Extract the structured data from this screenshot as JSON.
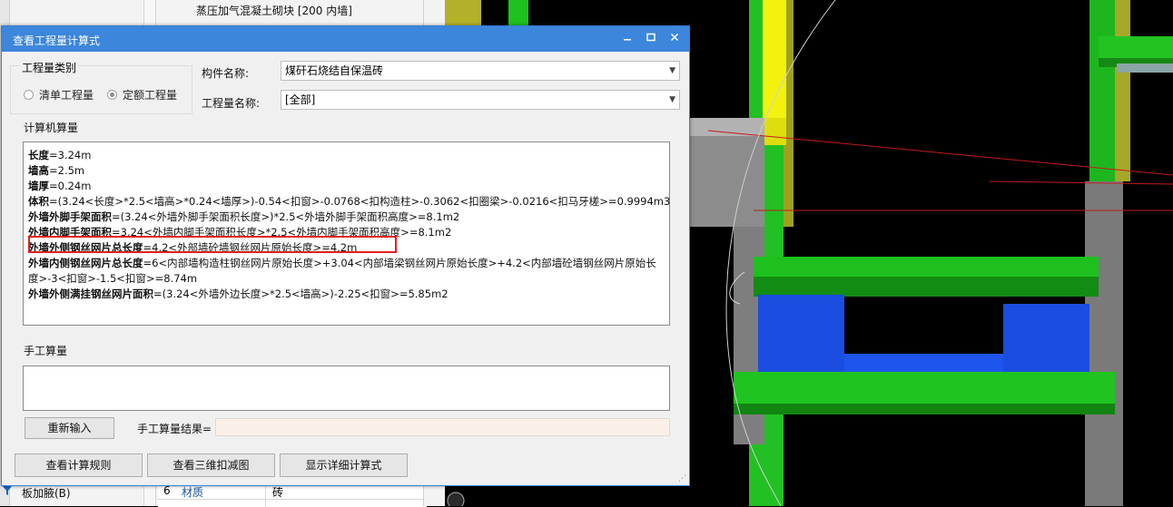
{
  "background": {
    "top_item": "蒸压加气混凝土砌块 [200 内墙]",
    "tree_item": "板加腋(B)",
    "property_row": {
      "num": "6",
      "name": "材质",
      "value": "砖"
    }
  },
  "dialog": {
    "title": "查看工程量计算式",
    "quantity_type": {
      "title": "工程量类别",
      "options": [
        "清单工程量",
        "定额工程量"
      ],
      "selected": "定额工程量"
    },
    "component_label": "构件名称:",
    "component_value": "煤矸石烧结自保温砖",
    "quantity_name_label": "工程量名称:",
    "quantity_name_value": "[全部]",
    "computer_section": "计算机算量",
    "lines": [
      {
        "name": "长度",
        "expr": "=3.24m"
      },
      {
        "name": "墙高",
        "expr": "=2.5m"
      },
      {
        "name": "墙厚",
        "expr": "=0.24m"
      },
      {
        "name": "体积",
        "expr": "=(3.24<长度>*2.5<墙高>*0.24<墙厚>)-0.54<扣窗>-0.0768<扣构造柱>-0.3062<扣圈梁>-0.0216<扣马牙槎>=0.9994m3"
      },
      {
        "name": "外墙外脚手架面积",
        "expr": "=(3.24<外墙外脚手架面积长度>)*2.5<外墙外脚手架面积高度>=8.1m2"
      },
      {
        "name": "外墙内脚手架面积",
        "expr": "=3.24<外墙内脚手架面积长度>*2.5<外墙内脚手架面积高度>=8.1m2"
      },
      {
        "name": "外墙外侧钢丝网片总长度",
        "expr": "=4.2<外部墙砼墙钢丝网片原始长度>=4.2m"
      },
      {
        "name": "外墙内侧钢丝网片总长度",
        "expr": "=6<内部墙构造柱钢丝网片原始长度>+3.04<内部墙梁钢丝网片原始长度>+4.2<内部墙砼墙钢丝网片原始长度>-3<扣窗>-1.5<扣窗>=8.74m"
      },
      {
        "name": "外墙外侧满挂钢丝网片面积",
        "expr": "=(3.24<外墙外边长度>*2.5<墙高>)-2.25<扣窗>=5.85m2"
      }
    ],
    "manual_section": "手工算量",
    "reenter_button": "重新输入",
    "manual_result_label": "手工算量结果=",
    "manual_result_value": "",
    "buttons": {
      "rules": "查看计算规则",
      "view3d": "查看三维扣减图",
      "detail": "显示详细计算式"
    }
  }
}
